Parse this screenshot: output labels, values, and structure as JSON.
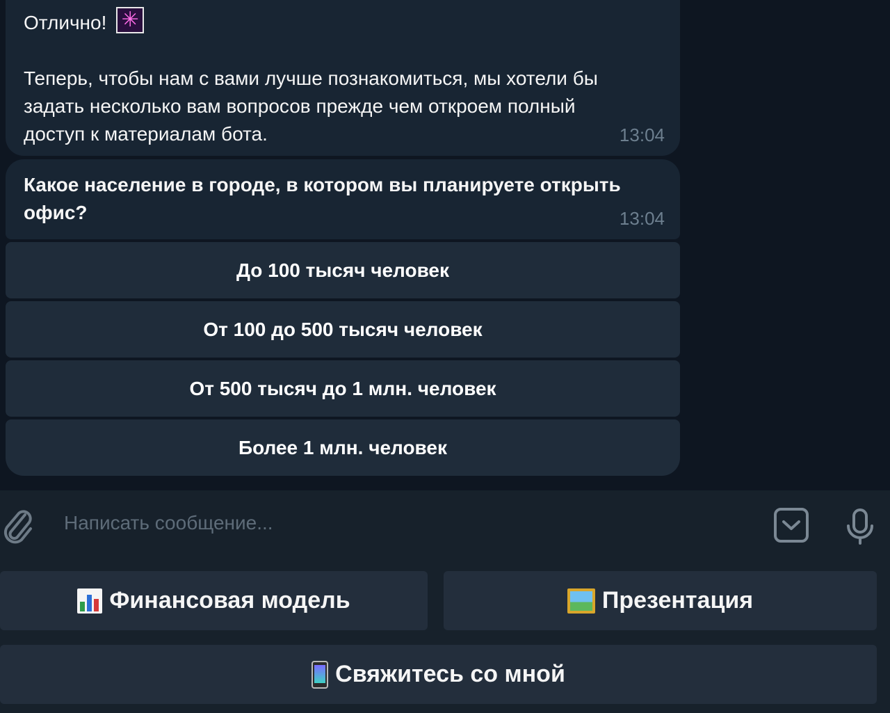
{
  "messages": [
    {
      "lines": [
        "Отлично!"
      ],
      "body_lines": [
        "Теперь, чтобы нам с вами лучше познакомиться, мы хотели бы",
        "задать несколько вам вопросов прежде чем откроем полный",
        "доступ к материалам бота."
      ],
      "emoji_icon": "sparkle-icon",
      "time": "13:04"
    },
    {
      "lines": [
        "Какое население в городе, в котором вы планируете открыть",
        "офис?"
      ],
      "time": "13:04"
    }
  ],
  "inline_buttons": [
    "До 100 тысяч человек",
    "От 100 до 500 тысяч человек",
    "От 500 тысяч до 1 млн. человек",
    "Более 1 млн. человек"
  ],
  "composer": {
    "placeholder": "Написать сообщение...",
    "icons": [
      "paperclip-icon",
      "keyboard-toggle-icon",
      "microphone-icon"
    ]
  },
  "reply_keyboard": {
    "row1": [
      {
        "label": "Финансовая модель",
        "icon": "bar-chart-icon"
      },
      {
        "label": "Презентация",
        "icon": "framed-picture-icon"
      }
    ],
    "row2": [
      {
        "label": "Свяжитесь со мной",
        "icon": "mobile-phone-icon"
      }
    ]
  },
  "colors": {
    "background": "#0e1621",
    "bubble": "#182533",
    "inline_button": "#1f2c3a",
    "input_bar": "#17212b",
    "keyboard_button": "#232e3c",
    "time_text": "#6d7f8f",
    "placeholder_text": "#5e6c79"
  }
}
